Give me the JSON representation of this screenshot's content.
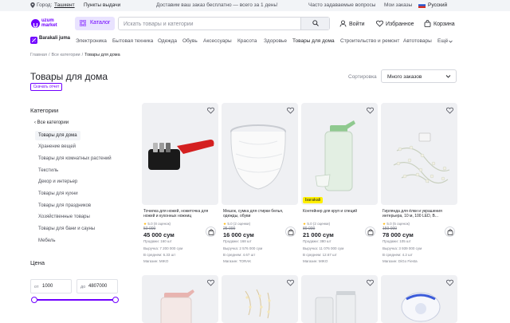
{
  "topbar": {
    "city_label": "Город:",
    "city": "Ташкент",
    "pickup": "Пункты выдачи",
    "delivery": "Доставим ваш заказ бесплатно — всего за 1 день!",
    "faq": "Часто задаваемые вопросы",
    "orders": "Мои заказы",
    "lang": "Русский"
  },
  "header": {
    "logo_line1": "uzum",
    "logo_line2": "market",
    "catalog": "Каталог",
    "search_placeholder": "Искать товары и категории",
    "login": "Войти",
    "favorites": "Избранное",
    "cart": "Корзина"
  },
  "nav": {
    "promo": "Barakali juma",
    "items": [
      "Электроника",
      "Бытовая техника",
      "Одежда",
      "Обувь",
      "Аксессуары",
      "Красота",
      "Здоровье",
      "Товары для дома",
      "Строительство и ремонт",
      "Автотовары",
      "Ещё"
    ]
  },
  "breadcrumb": [
    "Главная",
    "/",
    "Все категории",
    "/",
    "Товары для дома"
  ],
  "page": {
    "title": "Товары для дома",
    "report": "Скачать отчет",
    "sort_label": "Сортировка",
    "sort_value": "Много заказов"
  },
  "sidebar": {
    "heading": "Категории",
    "back": "Все категории",
    "items": [
      "Товары для дома",
      "Хранение вещей",
      "Товары для комнатных растений",
      "Текстиль",
      "Декор и интерьер",
      "Товары для кухни",
      "Товары для праздников",
      "Хозяйственные товары",
      "Товары для бани и сауны",
      "Мебель"
    ],
    "price_heading": "Цена",
    "price_from_prefix": "от",
    "price_from": "1000",
    "price_to_prefix": "до",
    "price_to": "4807000"
  },
  "products": [
    {
      "name": "Точилка для ножей, ножеточка для ножей и кухонных ножниц",
      "rating": "5.0 (8 оценок)",
      "old_price": "50 000",
      "price": "45 000 сум",
      "sales": "Продажи: 160 шт",
      "revenue": "Выручка: 7 200 000 сум",
      "avg": "В среднем: 6.33 шт",
      "shop": "Магазин: MIKO",
      "badge": ""
    },
    {
      "name": "Мешок, сумка для стирки белья, одежды, обуви",
      "rating": "5.0 (2 оценки)",
      "old_price": "25 000",
      "price": "16 000 сум",
      "sales": "Продажи: 168 шт",
      "revenue": "Выручка: 2 576 000 сум",
      "avg": "В среднем: 4.67 шт",
      "shop": "Магазин: TORAK",
      "badge": ""
    },
    {
      "name": "Контейнер для круп и специй",
      "rating": "5.0 (2 оценки)",
      "old_price": "89 000",
      "price": "21 000 сум",
      "sales": "Продажи: 380 шт",
      "revenue": "Выручка: 11 076 000 сум",
      "avg": "В среднем: 12.67 шт",
      "shop": "Магазин: MIKO",
      "badge": "barakali"
    },
    {
      "name": "Гирлянда для ёлки и украшения интерьера, 10 м, 100 LED, В...",
      "rating": "5.0 (5 оценок)",
      "old_price": "159 000",
      "price": "78 000 сум",
      "sales": "Продажи: 105 шт",
      "revenue": "Выручка: 3 939 000 сум",
      "avg": "В среднем: 4.2 шт",
      "shop": "Магазин: DiGo Fiesta",
      "badge": ""
    }
  ]
}
